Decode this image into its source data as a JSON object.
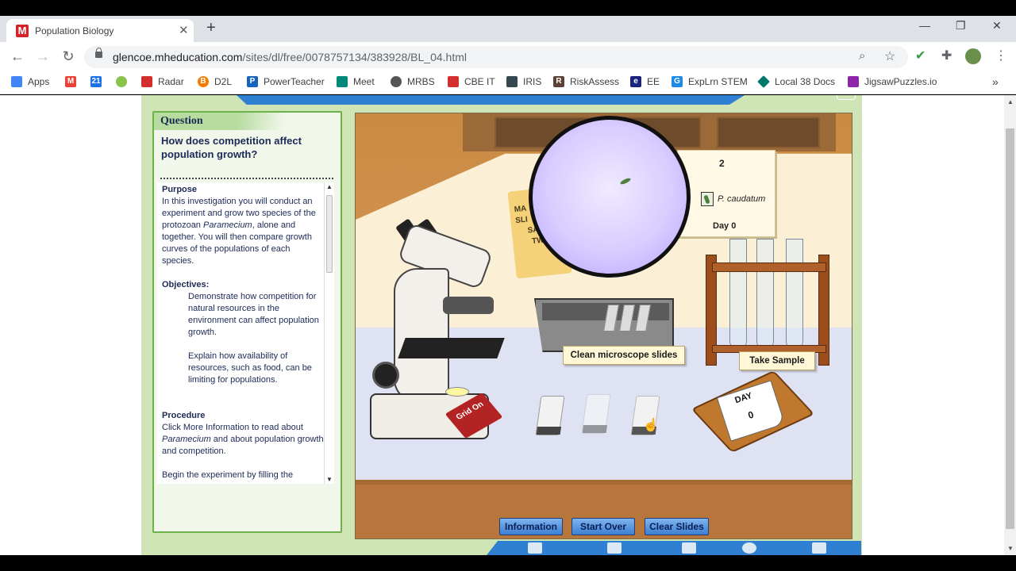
{
  "browser": {
    "tab_title": "Population Biology",
    "tab_favicon": "M",
    "url_host": "glencoe.mheducation.com",
    "url_path": "/sites/dl/free/0078757134/383928/BL_04.html",
    "bookmarks": [
      {
        "label": "Apps",
        "icon": "apps-grid-icon",
        "color": "#4285f4"
      },
      {
        "label": "",
        "icon": "gmail-icon",
        "color": "#ea4335"
      },
      {
        "label": "",
        "icon": "calendar-icon",
        "color": "#1a73e8"
      },
      {
        "label": "",
        "icon": "globe-icon",
        "color": "#8bc34a"
      },
      {
        "label": "Radar",
        "icon": "maple-leaf-icon",
        "color": "#d32f2f"
      },
      {
        "label": "D2L",
        "icon": "d2l-icon",
        "color": "#f57c00"
      },
      {
        "label": "PowerTeacher",
        "icon": "powerteacher-icon",
        "color": "#1565c0"
      },
      {
        "label": "Meet",
        "icon": "meet-icon",
        "color": "#00897b"
      },
      {
        "label": "MRBS",
        "icon": "globe-icon",
        "color": "#555555"
      },
      {
        "label": "CBE IT",
        "icon": "flag-icon",
        "color": "#d32f2f"
      },
      {
        "label": "IRIS",
        "icon": "iris-icon",
        "color": "#37474f"
      },
      {
        "label": "RiskAssess",
        "icon": "riskassess-icon",
        "color": "#5d4037"
      },
      {
        "label": "EE",
        "icon": "ee-icon",
        "color": "#1a237e"
      },
      {
        "label": "ExpLrn STEM",
        "icon": "g-icon",
        "color": "#1e88e5"
      },
      {
        "label": "Local 38 Docs",
        "icon": "diamond-icon",
        "color": "#00796b"
      },
      {
        "label": "JigsawPuzzles.io",
        "icon": "puzzle-icon",
        "color": "#8e24aa"
      }
    ]
  },
  "question": {
    "heading": "Question",
    "text": "How does competition affect population growth?",
    "purpose_title": "Purpose",
    "purpose_1": "In this investigation you will conduct an experiment and grow two species of the protozoan ",
    "purpose_species": "Paramecium",
    "purpose_2": ", alone and together. You will then compare growth curves of the populations of each species.",
    "objectives_title": "Objectives:",
    "objective_1": "Demonstrate how competition for natural resources in the environment can affect population growth.",
    "objective_2": "Explain how availability of resources, such as food, can be limiting for populations.",
    "procedure_title": "Procedure",
    "procedure_1": "Click More Information to read about ",
    "procedure_species": "Paramecium",
    "procedure_2": " and about population growth and competition.",
    "procedure_3": "Begin the experiment by filling the"
  },
  "lab": {
    "count_card": {
      "count": "2",
      "species": "P. caudatum",
      "day_label": "Day 0"
    },
    "poster_lines": [
      "MA",
      "SLI",
      "SA",
      "TW"
    ],
    "grid_button": "Grid On",
    "clean_slides_label": "Clean microscope slides",
    "take_sample_label": "Take Sample",
    "day_card_title": "DAY",
    "day_card_value": "0"
  },
  "buttons": {
    "information": "Information",
    "start_over": "Start Over",
    "clear_slides": "Clear Slides"
  },
  "colors": {
    "panel_border": "#6db24a",
    "text_navy": "#1c2a56",
    "button_blue": "#3d7fd3",
    "app_background": "#cfe5b5"
  }
}
